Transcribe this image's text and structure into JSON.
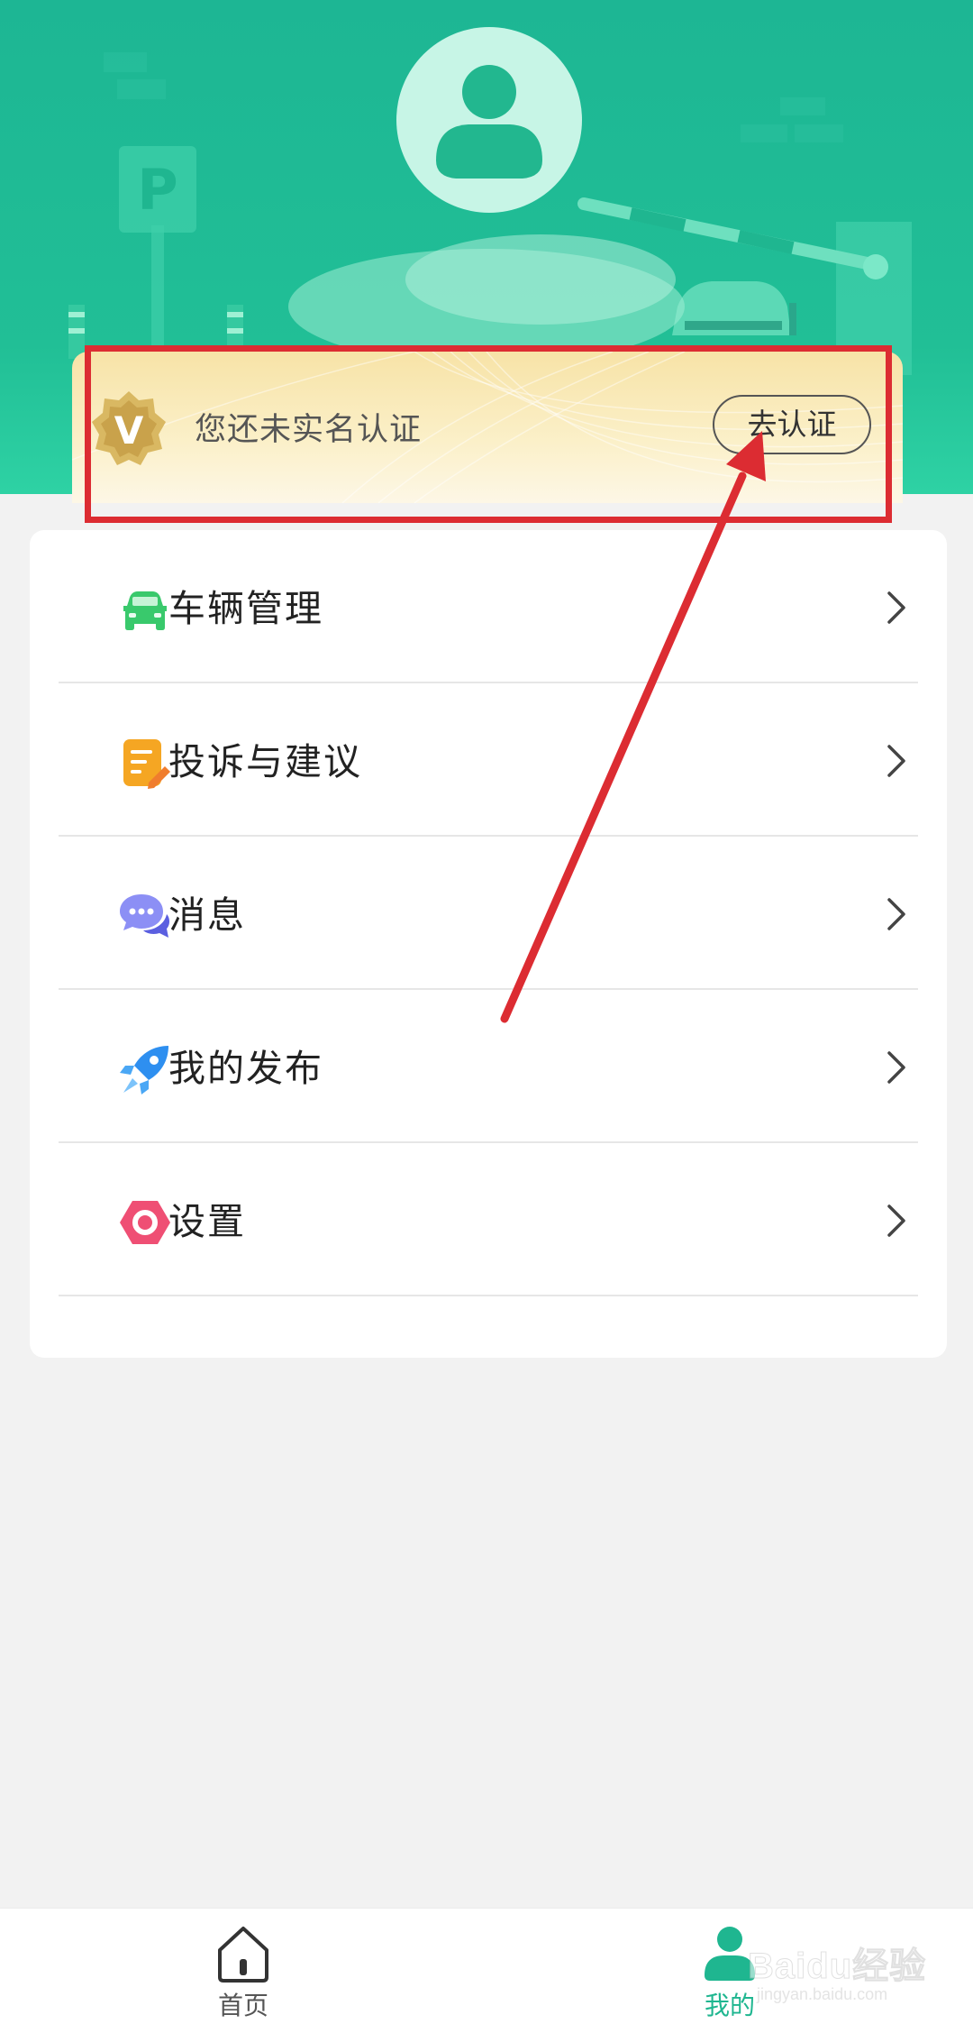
{
  "verify": {
    "text": "您还未实名认证",
    "button_label": "去认证",
    "badge_letter": "V"
  },
  "header": {
    "parking_sign": "P"
  },
  "menu": {
    "items": [
      {
        "label": "车辆管理",
        "icon": "car-icon",
        "color": "#39c96c"
      },
      {
        "label": "投诉与建议",
        "icon": "document-edit-icon",
        "color": "#f5a623"
      },
      {
        "label": "消息",
        "icon": "chat-bubbles-icon",
        "color": "#7b7ef2"
      },
      {
        "label": "我的发布",
        "icon": "rocket-icon",
        "color": "#2e8ff0"
      },
      {
        "label": "设置",
        "icon": "settings-hexagon-icon",
        "color": "#ef4f74"
      }
    ]
  },
  "tabbar": {
    "tabs": [
      {
        "label": "首页",
        "icon": "home-icon",
        "active": false
      },
      {
        "label": "我的",
        "icon": "user-icon",
        "active": true
      }
    ]
  },
  "watermark": {
    "text": "Baidu经验",
    "sub": "jingyan.baidu.com"
  },
  "colors": {
    "brand_green": "#1fb690",
    "annotation_red": "#dc2c32",
    "banner_gold": "#f7e3a7"
  }
}
